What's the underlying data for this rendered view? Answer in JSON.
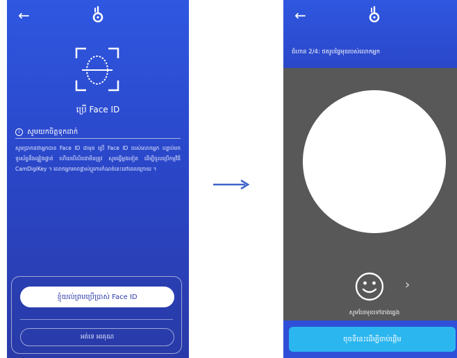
{
  "colors": {
    "primary_blue": "#2a47c9",
    "camera_gray": "#585858",
    "confirm_cyan": "#2bb6ef",
    "arrow_blue": "#3d63c8"
  },
  "left_screen": {
    "back_icon": "arrow-left",
    "logo_icon": "key-logo",
    "face_id_icon": "face-scan",
    "face_id_label": "ប្រើ Face ID",
    "note_icon": "info-circle",
    "note_title": "សូមយកចិត្តទុកដាក់",
    "note_body": "សូមប្រាកដថាអ្នកបាន Face ID ជាមុន ប្រើ Face ID របស់លោកអ្នក បន្ទាប់មកទូរស័ព្ទនឹងផ្ទៀងផ្ទាត់ ហើយបើសិនជាមិនត្រូវ សូមធ្វើម្តងទៀត ដើម្បីចូលប្រើកម្មវិធី CamDigiKey ។ លោកអ្នកអាចផ្លាស់ប្តូរការកំណត់នេះនៅពេលក្រោយ ។",
    "agree_button": "ខ្ញុំយល់ព្រមប្រើប្រាស់ Face ID",
    "skip_button": "អត់ទេ អរគុណ"
  },
  "flow_arrow_icon": "arrow-right",
  "right_screen": {
    "back_icon": "arrow-left",
    "logo_icon": "key-logo",
    "step_text": "ជំហាន 2/4: ថតរូបផ្ទៃមុខរបស់លោកអ្នក",
    "smile_icon": "smile-face",
    "next_icon": "chevron-right",
    "hint": "សូមបែរមុខទៅខាងឆ្វេង",
    "confirm_button": "ចុចទីនេះដើម្បីចាប់ផ្តើម"
  }
}
